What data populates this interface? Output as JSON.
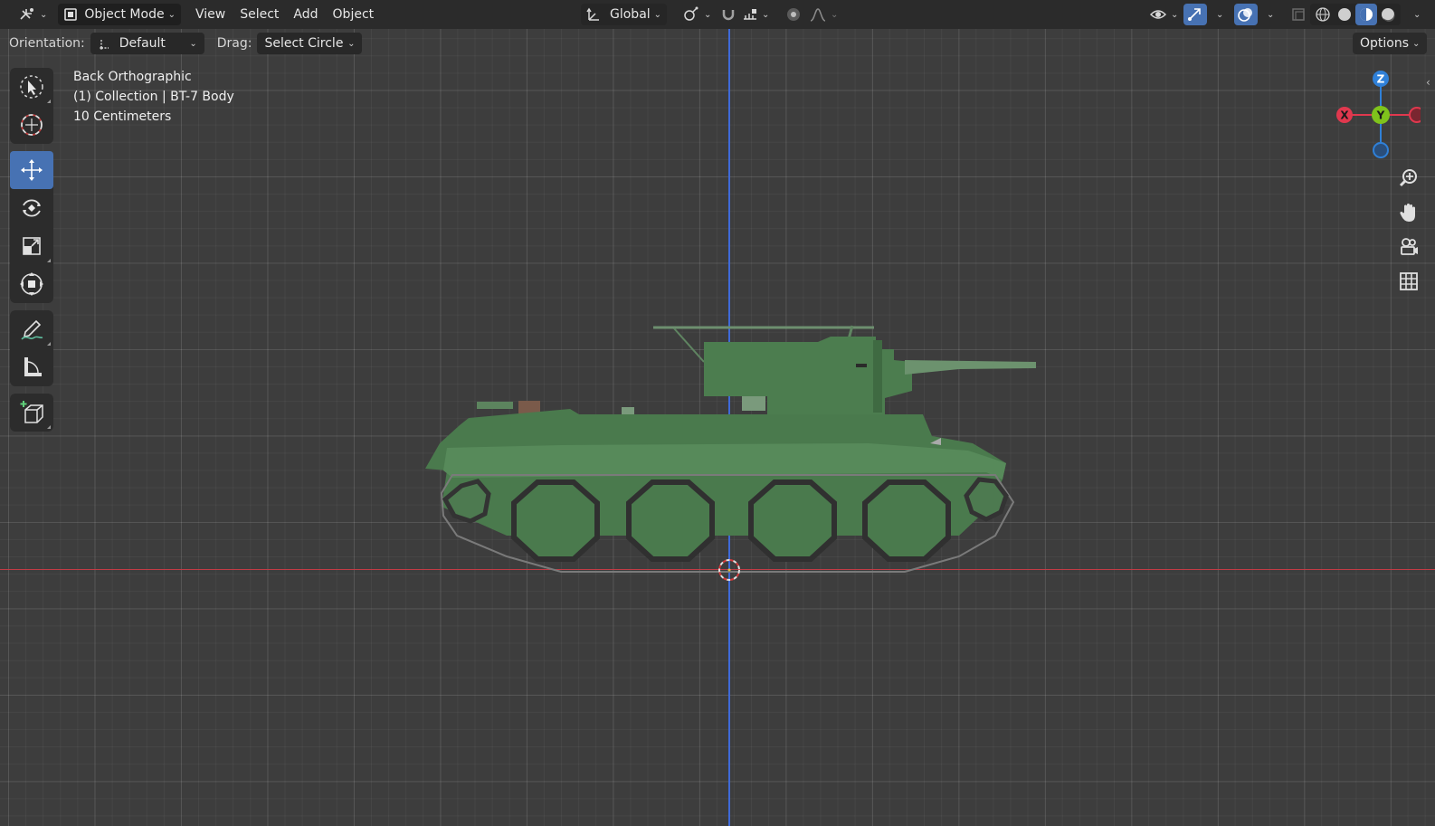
{
  "header": {
    "mode_label": "Object Mode",
    "menus": [
      "View",
      "Select",
      "Add",
      "Object"
    ],
    "transform_orientation": "Global"
  },
  "tool_options": {
    "orientation_label": "Orientation:",
    "orientation_value": "Default",
    "drag_label": "Drag:",
    "drag_value": "Select Circle",
    "options_label": "Options"
  },
  "viewport_info": {
    "view_name": "Back Orthographic",
    "collection": "(1) Collection | BT-7 Body",
    "scale": "10 Centimeters"
  },
  "gizmo": {
    "axis_z": "Z",
    "axis_y": "Y",
    "axis_x": "X"
  },
  "toolbar": {
    "tools": [
      "select-box",
      "cursor",
      "move",
      "rotate",
      "scale",
      "transform",
      "annotate",
      "measure",
      "add-cube"
    ],
    "active_tool": "move"
  },
  "colors": {
    "accent": "#4772b3",
    "axis_x": "#c23b45",
    "axis_y": "#3f6ad8",
    "tank_green": "#4a7a4d",
    "gizmo_x": "#e0384e",
    "gizmo_y": "#7fc31c",
    "gizmo_z": "#2f80d8"
  }
}
